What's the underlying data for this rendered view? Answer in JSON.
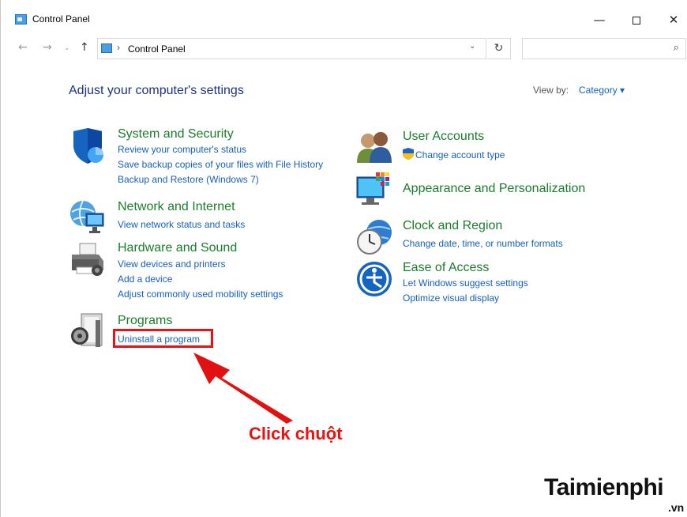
{
  "window": {
    "title": "Control Panel",
    "minimize": "—",
    "close": "✕"
  },
  "nav": {
    "back": "←",
    "forward": "→",
    "recent": "⌄",
    "up": "↑",
    "breadcrumb_sep": "›",
    "address": "Control Panel",
    "dropdown": "⌄",
    "refresh": "↻",
    "search_placeholder": "",
    "search_icon": "⌕"
  },
  "main": {
    "title": "Adjust your computer's settings",
    "view_by_label": "View by:",
    "view_by_value": "Category ▾"
  },
  "categories_left": [
    {
      "title": "System and Security",
      "icon": "shield-icon",
      "links": [
        "Review your computer's status",
        "Save backup copies of your files with File History",
        "Backup and Restore (Windows 7)"
      ]
    },
    {
      "title": "Network and Internet",
      "icon": "network-globe-icon",
      "links": [
        "View network status and tasks"
      ]
    },
    {
      "title": "Hardware and Sound",
      "icon": "printer-icon",
      "links": [
        "View devices and printers",
        "Add a device",
        "Adjust commonly used mobility settings"
      ]
    },
    {
      "title": "Programs",
      "icon": "programs-disc-icon",
      "links": [
        "Uninstall a program"
      ]
    }
  ],
  "categories_right": [
    {
      "title": "User Accounts",
      "icon": "users-icon",
      "links": [
        "Change account type"
      ]
    },
    {
      "title": "Appearance and Personalization",
      "icon": "monitor-palette-icon",
      "links": []
    },
    {
      "title": "Clock and Region",
      "icon": "clock-globe-icon",
      "links": [
        "Change date, time, or number formats"
      ]
    },
    {
      "title": "Ease of Access",
      "icon": "ease-of-access-icon",
      "links": [
        "Let Windows suggest settings",
        "Optimize visual display"
      ]
    }
  ],
  "annotation": {
    "text": "Click chuột",
    "color": "#ee1111"
  },
  "watermark": {
    "brand": "Taimienphi",
    "suffix": ".vn"
  },
  "colors": {
    "title_blue": "#1e3287",
    "category_green": "#1a7d2a",
    "link_blue": "#1560c0"
  }
}
